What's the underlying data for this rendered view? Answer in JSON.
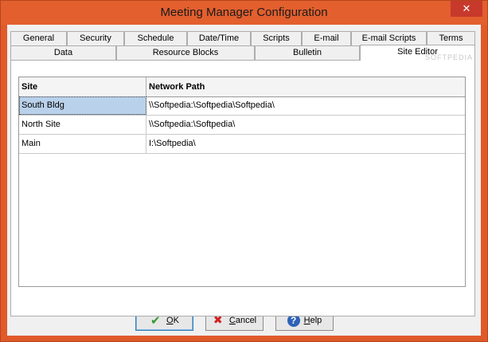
{
  "window": {
    "title": "Meeting Manager Configuration",
    "close_glyph": "✕"
  },
  "tabs": {
    "row1": [
      {
        "label": "General"
      },
      {
        "label": "Security"
      },
      {
        "label": "Schedule"
      },
      {
        "label": "Date/Time"
      },
      {
        "label": "Scripts"
      },
      {
        "label": "E-mail"
      },
      {
        "label": "E-mail Scripts"
      },
      {
        "label": "Terms"
      }
    ],
    "row2": [
      {
        "label": "Data"
      },
      {
        "label": "Resource Blocks"
      },
      {
        "label": "Bulletin"
      },
      {
        "label": "Site Editor"
      }
    ],
    "active": "Site Editor"
  },
  "grid": {
    "columns": [
      "Site",
      "Network Path"
    ],
    "rows": [
      {
        "site": "South Bldg",
        "path": "\\\\Softpedia:\\Softpedia\\Softpedia\\"
      },
      {
        "site": "North Site",
        "path": "\\\\Softpedia:\\Softpedia\\"
      },
      {
        "site": "Main",
        "path": "I:\\Softpedia\\"
      }
    ],
    "selected_row": 0
  },
  "buttons": {
    "ok": {
      "mnemonic": "O",
      "rest": "K"
    },
    "cancel": {
      "mnemonic": "C",
      "rest": "ancel"
    },
    "help": {
      "mnemonic": "H",
      "rest": "elp"
    }
  },
  "watermark": "SOFTPEDIA",
  "icons": {
    "ok": "check-icon",
    "cancel": "x-icon",
    "help": "help-icon",
    "close": "close-icon"
  }
}
